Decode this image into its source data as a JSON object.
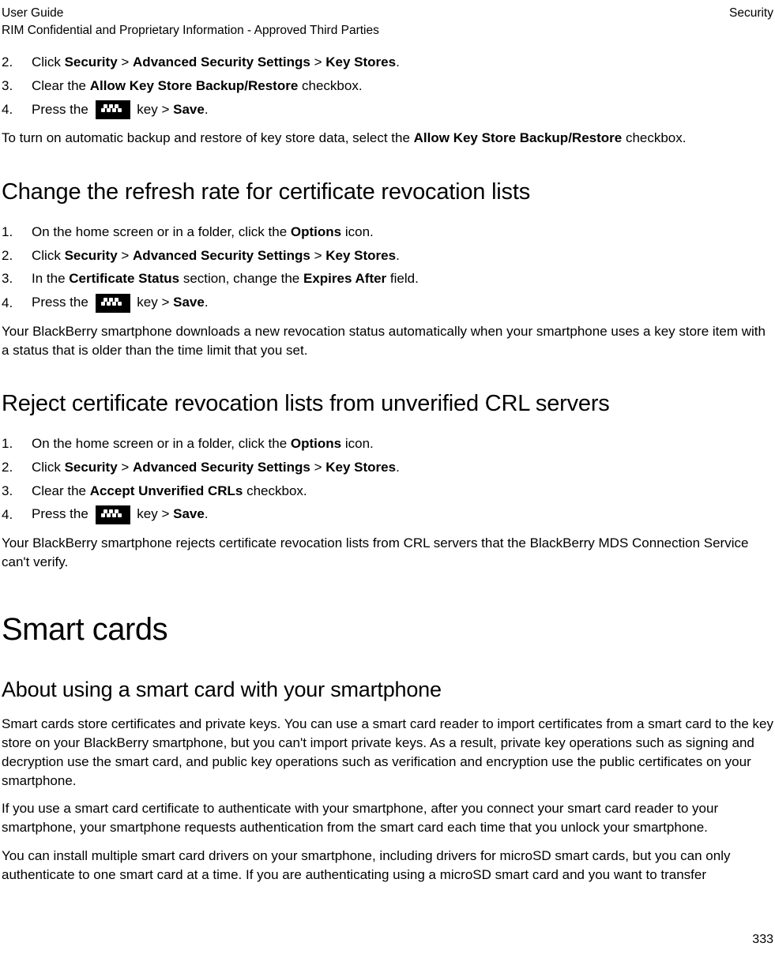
{
  "header": {
    "left_line1": "User Guide",
    "left_line2": "RIM Confidential and Proprietary Information - Approved Third Parties",
    "right": "Security"
  },
  "section_top": {
    "steps": [
      {
        "num": "2.",
        "parts": [
          "Click ",
          "Security",
          " > ",
          "Advanced Security Settings",
          " > ",
          "Key Stores",
          "."
        ]
      },
      {
        "num": "3.",
        "parts": [
          "Clear the ",
          "Allow Key Store Backup/Restore",
          " checkbox."
        ]
      },
      {
        "num": "4.",
        "parts_key": {
          "before": "Press the ",
          "after_key": " key > ",
          "bold": "Save",
          "period": "."
        }
      }
    ],
    "note_parts": [
      "To turn on automatic backup and restore of key store data, select the ",
      "Allow Key Store Backup/Restore",
      " checkbox."
    ]
  },
  "section_crl_refresh": {
    "heading": "Change the refresh rate for certificate revocation lists",
    "steps": [
      {
        "num": "1.",
        "parts": [
          "On the home screen or in a folder, click the ",
          "Options",
          " icon."
        ]
      },
      {
        "num": "2.",
        "parts": [
          "Click ",
          "Security",
          " > ",
          "Advanced Security Settings",
          " > ",
          "Key Stores",
          "."
        ]
      },
      {
        "num": "3.",
        "parts": [
          "In the ",
          "Certificate Status",
          " section, change the ",
          "Expires After",
          " field."
        ]
      },
      {
        "num": "4.",
        "parts_key": {
          "before": "Press the ",
          "after_key": " key > ",
          "bold": "Save",
          "period": "."
        }
      }
    ],
    "note": "Your BlackBerry smartphone downloads a new revocation status automatically when your smartphone uses a key store item with a status that is older than the time limit that you set."
  },
  "section_crl_reject": {
    "heading": "Reject certificate revocation lists from unverified CRL servers",
    "steps": [
      {
        "num": "1.",
        "parts": [
          "On the home screen or in a folder, click the ",
          "Options",
          " icon."
        ]
      },
      {
        "num": "2.",
        "parts": [
          "Click ",
          "Security",
          " > ",
          "Advanced Security Settings",
          " > ",
          "Key Stores",
          "."
        ]
      },
      {
        "num": "3.",
        "parts": [
          "Clear the ",
          "Accept Unverified CRLs",
          " checkbox."
        ]
      },
      {
        "num": "4.",
        "parts_key": {
          "before": "Press the ",
          "after_key": " key > ",
          "bold": "Save",
          "period": "."
        }
      }
    ],
    "note": "Your BlackBerry smartphone rejects certificate revocation lists from CRL servers that the BlackBerry MDS Connection Service can't verify."
  },
  "smartcards": {
    "heading": "Smart cards",
    "subheading": "About using a smart card with your smartphone",
    "para1": "Smart cards store certificates and private keys. You can use a smart card reader to import certificates from a smart card to the key store on your BlackBerry smartphone, but you can't import private keys. As a result, private key operations such as signing and decryption use the smart card, and public key operations such as verification and encryption use the public certificates on your smartphone.",
    "para2": "If you use a smart card certificate to authenticate with your smartphone, after you connect your smart card reader to your smartphone, your smartphone requests authentication from the smart card each time that you unlock your smartphone.",
    "para3": "You can install multiple smart card drivers on your smartphone, including drivers for microSD smart cards, but you can only authenticate to one smart card at a time. If you are authenticating using a microSD smart card and you want to transfer"
  },
  "page_number": "333"
}
